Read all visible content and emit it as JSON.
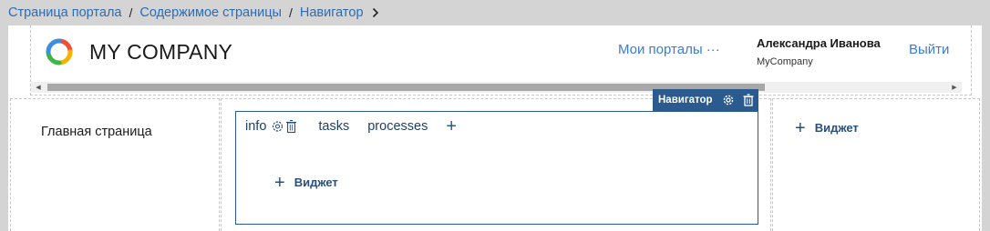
{
  "breadcrumb": {
    "items": [
      "Страница портала",
      "Содержимое страницы",
      "Навигатор"
    ],
    "separator": "/"
  },
  "header": {
    "company": "MY COMPANY",
    "portals_link": "Мои порталы ···",
    "user_name": "Александра Иванова",
    "user_company": "MyCompany",
    "logout": "Выйти"
  },
  "left_column": {
    "label": "Главная страница"
  },
  "navigator": {
    "toolbar_label": "Навигатор",
    "tabs": [
      "info",
      "tasks",
      "processes"
    ],
    "add_tab": "+",
    "add_widget": "Виджет"
  },
  "right_column": {
    "add_widget": "Виджет"
  },
  "colors": {
    "link": "#2a6cb5",
    "accent": "#2a5a8e",
    "header_link": "#3a7cd0"
  }
}
